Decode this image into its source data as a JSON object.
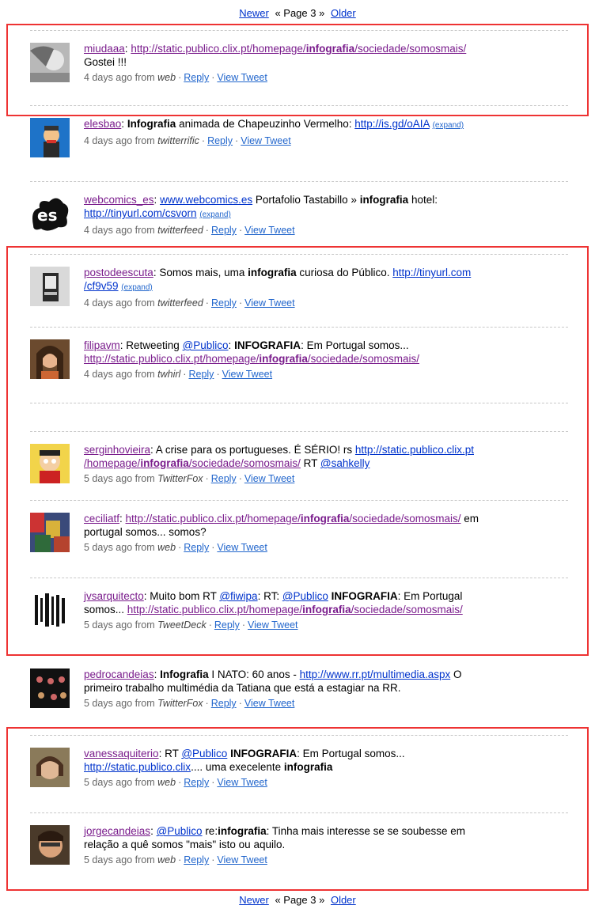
{
  "pager": {
    "newer": "Newer",
    "middle": "« Page 3 »",
    "older": "Older"
  },
  "tweets": [
    {
      "user": "miudaaa",
      "parts": [
        {
          "t": ": "
        },
        {
          "link": "http://static.publico.clix.pt/homepage/",
          "bold_link": "infografia",
          "link2": "/sociedade/somosmais/",
          "visited": true
        }
      ],
      "line2": "Gostei !!!",
      "time": "4 days ago from",
      "source": "web",
      "reply": "Reply",
      "view": "View Tweet"
    }
  ],
  "t1": {
    "user": "miudaaa",
    "sep": ": ",
    "link_a": "http://static.publico.clix.pt/homepage/",
    "link_b": "infografia",
    "link_c": "/sociedade/somosmais/",
    "line2": "Gostei !!!",
    "time": "4 days ago from",
    "source": "web",
    "reply": "Reply",
    "view": "View Tweet"
  },
  "t2": {
    "user": "elesbao",
    "sep": ": ",
    "b1": "Infografia",
    "text1": " animada de Chapeuzinho Vermelho: ",
    "link": "http://is.gd/oAIA",
    "expand": "(expand)",
    "time": "4 days ago from",
    "source": "twitterrific",
    "reply": "Reply",
    "view": "View Tweet"
  },
  "t3": {
    "user": "webcomics_es",
    "sep": ": ",
    "link1": "www.webcomics.es",
    "text1": " Portafolio Tastabillo » ",
    "b1": "infografia",
    "text2": " hotel:",
    "link2": "http://tinyurl.com/csvorn",
    "expand": "(expand)",
    "time": "4 days ago from",
    "source": "twitterfeed",
    "reply": "Reply",
    "view": "View Tweet"
  },
  "t4": {
    "user": "postodeescuta",
    "text1": ": Somos mais, uma ",
    "b1": "infografia",
    "text2": " curiosa do Público. ",
    "link_a": "http://tinyurl.com",
    "link_b": "/cf9v59",
    "expand": "(expand)",
    "time": "4 days ago from",
    "source": "twitterfeed",
    "reply": "Reply",
    "view": "View Tweet"
  },
  "t5": {
    "user": "filipavm",
    "text1": ": Retweeting ",
    "mention": "@Publico",
    "sep": ": ",
    "b1": "INFOGRAFIA",
    "text2": ": Em Portugal somos...",
    "link_a": "http://static.publico.clix.pt/homepage/",
    "link_b": "infografia",
    "link_c": "/sociedade/somosmais/",
    "time": "4 days ago from",
    "source": "twhirl",
    "reply": "Reply",
    "view": "View Tweet"
  },
  "t6": {
    "user": "serginhovieira",
    "text1": ": A crise para os portugueses. É SÉRIO! rs ",
    "link_a": "http://static.publico.clix.pt",
    "link_b": "/homepage/",
    "link_c": "infografia",
    "link_d": "/sociedade/somosmais/",
    "text2": " RT ",
    "mention": "@sahkelly",
    "time": "5 days ago from",
    "source": "TwitterFox",
    "reply": "Reply",
    "view": "View Tweet"
  },
  "t7": {
    "user": "ceciliatf",
    "sep": ": ",
    "link_a": "http://static.publico.clix.pt/homepage/",
    "link_b": "infografia",
    "link_c": "/sociedade/somosmais/",
    "text1": " em",
    "line2": "portugal somos... somos?",
    "time": "5 days ago from",
    "source": "web",
    "reply": "Reply",
    "view": "View Tweet"
  },
  "t8": {
    "user": "jvsarquitecto",
    "text1": ": Muito bom RT ",
    "mention1": "@fiwipa",
    "text2": ": RT: ",
    "mention2": "@Publico",
    "b1": "INFOGRAFIA",
    "text3": ": Em Portugal",
    "text4": "somos... ",
    "link_a": "http://static.publico.clix.pt/homepage/",
    "link_b": "infografia",
    "link_c": "/sociedade/somosmais/",
    "time": "5 days ago from",
    "source": "TweetDeck",
    "reply": "Reply",
    "view": "View Tweet"
  },
  "t9": {
    "user": "pedrocandeias",
    "sep": ": ",
    "b1": "Infografia",
    "text1": " I NATO: 60 anos - ",
    "link": "http://www.rr.pt/multimedia.aspx",
    "text2": " O",
    "line2": "primeiro trabalho multimédia da Tatiana que está a estagiar na RR.",
    "time": "5 days ago from",
    "source": "TwitterFox",
    "reply": "Reply",
    "view": "View Tweet"
  },
  "t10": {
    "user": "vanessaquiterio",
    "text1": ": RT ",
    "mention": "@Publico",
    "b1": "INFOGRAFIA",
    "text2": ": Em Portugal somos...",
    "link": "http://static.publico.clix",
    "text3": ".... uma execelente ",
    "b2": "infografia",
    "time": "5 days ago from",
    "source": "web",
    "reply": "Reply",
    "view": "View Tweet"
  },
  "t11": {
    "user": "jorgecandeias",
    "sep": ": ",
    "mention": "@Publico",
    "text1": " re:",
    "b1": "infografia",
    "text2": ": Tinha mais interesse se se soubesse em",
    "line2": "relação a quê somos \"mais\" isto ou aquilo.",
    "time": "5 days ago from",
    "source": "web",
    "reply": "Reply",
    "view": "View Tweet"
  }
}
